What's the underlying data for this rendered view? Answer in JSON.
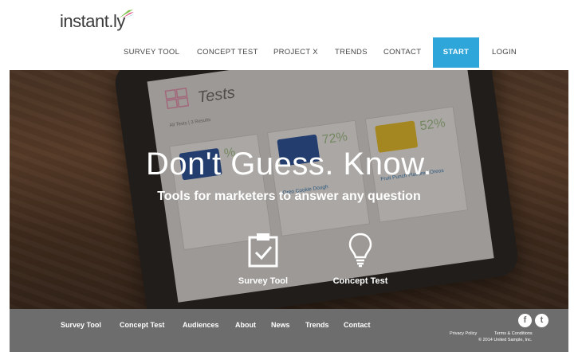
{
  "logo": {
    "text": "instant",
    "suffix": ".ly"
  },
  "nav": {
    "items": [
      {
        "label": "SURVEY TOOL"
      },
      {
        "label": "CONCEPT TEST"
      },
      {
        "label": "PROJECT X"
      },
      {
        "label": "TRENDS"
      },
      {
        "label": "CONTACT"
      },
      {
        "label": "START"
      },
      {
        "label": "LOGIN"
      }
    ]
  },
  "hero": {
    "headline": "Don't Guess. Know.",
    "subheadline": "Tools for marketers to answer any question",
    "tools": [
      {
        "label": "Survey Tool",
        "icon": "clipboard-check-icon"
      },
      {
        "label": "Concept Test",
        "icon": "lightbulb-icon"
      }
    ],
    "screen": {
      "title": "Tests",
      "subtitle": "All Tests | 3 Results",
      "cards": [
        {
          "pct": "%",
          "name": ""
        },
        {
          "pct": "72%",
          "name": "Oreo Cookie Dough"
        },
        {
          "pct": "52%",
          "name": "Fruit Punch Flavored Oreos"
        }
      ]
    }
  },
  "footer": {
    "links": [
      {
        "label": "Survey Tool"
      },
      {
        "label": "Concept Test"
      },
      {
        "label": "Audiences"
      },
      {
        "label": "About"
      },
      {
        "label": "News"
      },
      {
        "label": "Trends"
      },
      {
        "label": "Contact"
      }
    ],
    "social": {
      "facebook": "f",
      "twitter": "t"
    },
    "privacy": "Privacy Policy",
    "terms": "Terms & Conditions",
    "copyright": "© 2014 United Sample, Inc."
  },
  "colors": {
    "accent": "#2fa6d9",
    "footer": "#6d6d6d"
  }
}
